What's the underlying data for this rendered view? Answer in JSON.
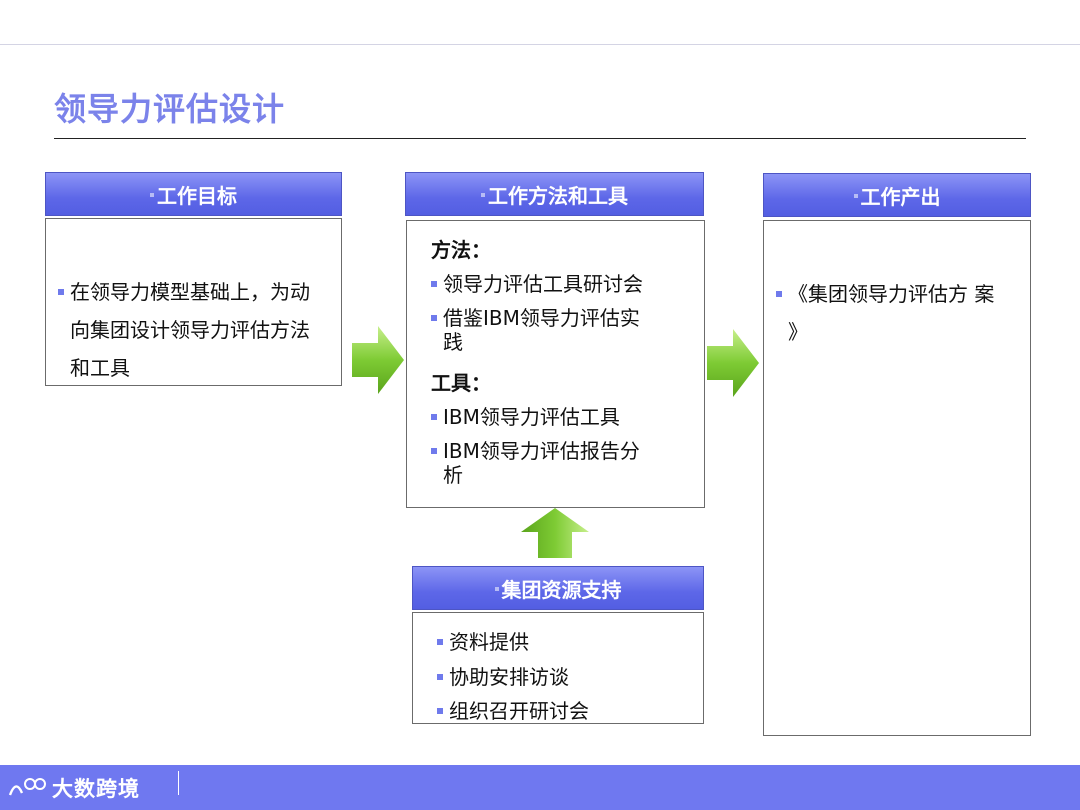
{
  "title": "领导力评估设计",
  "goal": {
    "header": "工作目标",
    "lines": [
      "在领导力模型基础上，为动",
      "向集团设计领导力评估方法",
      "和工具"
    ]
  },
  "methods": {
    "header": "工作方法和工具",
    "method_label": "方法：",
    "method_items": [
      {
        "lines": [
          "领导力评估工具研讨会"
        ]
      },
      {
        "lines": [
          "借鉴IBM领导力评估实",
          "践"
        ]
      }
    ],
    "tool_label": "工具：",
    "tool_items": [
      {
        "lines": [
          "IBM领导力评估工具"
        ]
      },
      {
        "lines": [
          "IBM领导力评估报告分",
          "析"
        ]
      }
    ]
  },
  "output": {
    "header": "工作产出",
    "lines": [
      "《集团领导力评估方 案",
      "》"
    ]
  },
  "support": {
    "header": "集团资源支持",
    "items": [
      "资料提供",
      "协助安排访谈",
      "组织召开研讨会"
    ]
  },
  "footer": {
    "logo_text": "大数跨境"
  },
  "colors": {
    "accent": "#7b83ea",
    "header_fill": "#5d67e8",
    "bullet": "#6f7aec",
    "arrow_green": "#79c832",
    "footer_bar": "#6f78f0"
  }
}
